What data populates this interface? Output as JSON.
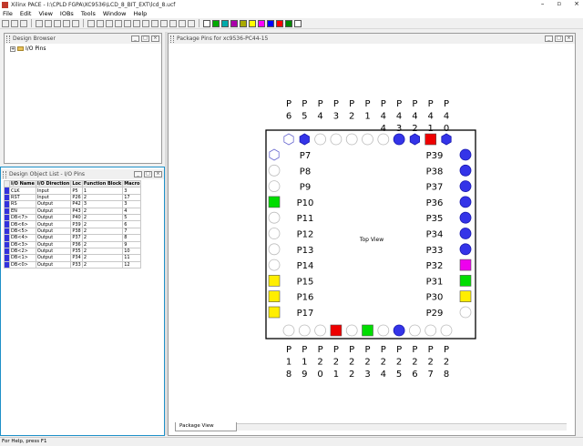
{
  "window": {
    "title": "Xilinx PACE - I:\\CPLD FGPA\\XC9536\\LCD_8_BIT_EXT\\lcd_8.ucf",
    "controls": [
      "–",
      "▫",
      "×"
    ]
  },
  "menu": [
    "File",
    "Edit",
    "View",
    "IOBs",
    "Tools",
    "Window",
    "Help"
  ],
  "toolbar": {
    "palette": [
      "#ffffff",
      "#00aa00",
      "#00aaaa",
      "#aa00aa",
      "#aaaa00",
      "#ffff00",
      "#ff00ff",
      "#0000ff",
      "#ff0000",
      "#008800",
      "#ffffff"
    ]
  },
  "design_browser": {
    "title": "Design Browser",
    "tree_root": "I/O Pins"
  },
  "object_list": {
    "title": "Design Object List - I/O Pins",
    "columns": [
      "I/O Name",
      "I/O Direction",
      "Loc",
      "Function Block",
      "Macro"
    ],
    "rows": [
      [
        "CLK",
        "Input",
        "P5",
        "1",
        "3"
      ],
      [
        "RST",
        "Input",
        "P26",
        "2",
        "17"
      ],
      [
        "RS",
        "Output",
        "P42",
        "3",
        "3"
      ],
      [
        "EN",
        "Output",
        "P43",
        "2",
        "4"
      ],
      [
        "DB<7>",
        "Output",
        "P40",
        "2",
        "5"
      ],
      [
        "DB<6>",
        "Output",
        "P39",
        "2",
        "6"
      ],
      [
        "DB<5>",
        "Output",
        "P38",
        "2",
        "7"
      ],
      [
        "DB<4>",
        "Output",
        "P37",
        "2",
        "8"
      ],
      [
        "DB<3>",
        "Output",
        "P36",
        "2",
        "9"
      ],
      [
        "DB<2>",
        "Output",
        "P35",
        "2",
        "10"
      ],
      [
        "DB<1>",
        "Output",
        "P34",
        "2",
        "11"
      ],
      [
        "DB<0>",
        "Output",
        "P33",
        "2",
        "12"
      ]
    ]
  },
  "package_view": {
    "title": "Package Pins for xc9536-PC44-15",
    "tab": "Package View",
    "center_label": "Top View",
    "top_labels": [
      "P6",
      "P5",
      "P4",
      "P3",
      "P2",
      "P1",
      "P44",
      "P43",
      "P42",
      "P41",
      "P40"
    ],
    "bottom_labels": [
      "P18",
      "P19",
      "P20",
      "P21",
      "P22",
      "P23",
      "P24",
      "P25",
      "P26",
      "P27",
      "P28"
    ],
    "left_labels": [
      "P7",
      "P8",
      "P9",
      "P10",
      "P11",
      "P12",
      "P13",
      "P14",
      "P15",
      "P16",
      "P17"
    ],
    "right_labels": [
      "P39",
      "P38",
      "P37",
      "P36",
      "P35",
      "P34",
      "P33",
      "P32",
      "P31",
      "P30",
      "P29"
    ],
    "top_pins": [
      "hex-outline",
      "hex-blue",
      "circle",
      "circle",
      "circle",
      "circle",
      "circle",
      "circle-blue",
      "hex-blue",
      "square-red",
      "hex-blue"
    ],
    "bottom_pins": [
      "circle",
      "circle",
      "circle",
      "square-red",
      "circle",
      "square-green",
      "circle",
      "circle-blue",
      "circle",
      "circle",
      "circle"
    ],
    "left_pins": [
      "hex-outline",
      "circle",
      "circle",
      "square-green",
      "circle",
      "circle",
      "circle",
      "circle",
      "square-yellow",
      "square-yellow",
      "square-yellow"
    ],
    "right_pins": [
      "circle-blue",
      "circle-blue",
      "circle-blue",
      "circle-blue",
      "circle-blue",
      "circle-blue",
      "circle-blue",
      "square-magenta",
      "square-green",
      "square-yellow",
      "circle"
    ]
  },
  "status": "For Help, press F1"
}
